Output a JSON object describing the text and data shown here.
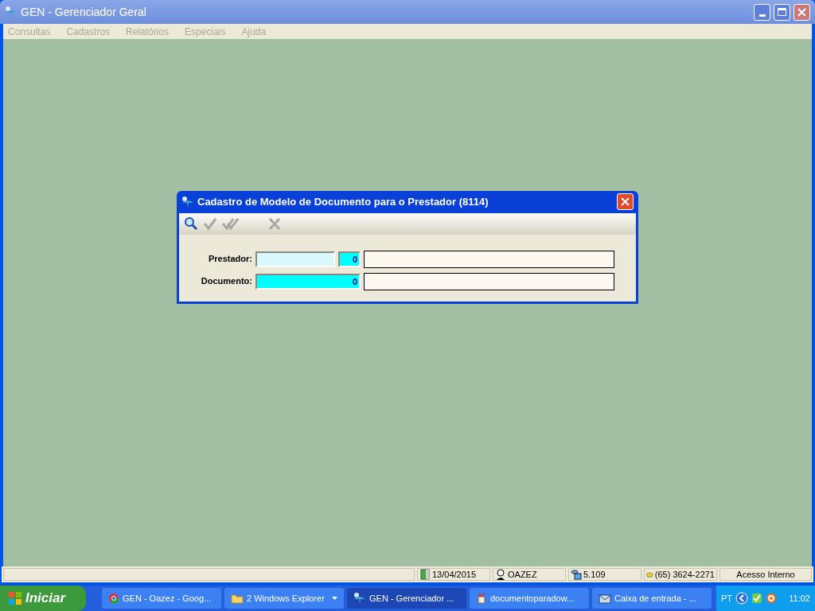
{
  "window": {
    "title": "GEN - Gerenciador Geral"
  },
  "menu": [
    {
      "label": "Consultas",
      "disabled": true
    },
    {
      "label": "Cadastros",
      "disabled": true
    },
    {
      "label": "Relatórios",
      "disabled": true
    },
    {
      "label": "Especiais",
      "disabled": true
    },
    {
      "label": "Ajuda",
      "disabled": true
    }
  ],
  "dialog": {
    "title": "Cadastro de Modelo de Documento para o Prestador (8114)",
    "toolbar": [
      {
        "kind": "search",
        "disabled": false
      },
      {
        "kind": "confirm",
        "disabled": true
      },
      {
        "kind": "confirm-all",
        "disabled": true
      },
      {
        "kind": "cancel",
        "disabled": true
      }
    ],
    "fields": [
      {
        "label": "Prestador:",
        "kind": "pair",
        "number": "0"
      },
      {
        "label": "Documento:",
        "kind": "single",
        "number": "0"
      }
    ]
  },
  "status_bar": [
    {
      "kind": "date",
      "text": "13/04/2015"
    },
    {
      "kind": "user",
      "text": "OAZEZ"
    },
    {
      "kind": "version",
      "text": "5.109"
    },
    {
      "kind": "phone",
      "text": "(65) 3624-2271"
    },
    {
      "kind": "plain",
      "text": "Acesso Interno"
    }
  ],
  "taskbar": {
    "start": "Iniciar",
    "items": [
      {
        "kind": "browser",
        "label": "GEN - Oazez - Goog...",
        "selected": false
      },
      {
        "kind": "folder",
        "label": "2 Windows Explorer",
        "selected": false,
        "group": true
      },
      {
        "kind": "app",
        "label": "GEN - Gerenciador ...",
        "selected": true
      },
      {
        "kind": "paint",
        "label": "documentoparadow...",
        "selected": false
      },
      {
        "kind": "mail",
        "label": "Caixa de entrada - ...",
        "selected": false
      }
    ],
    "tray": {
      "language": "PT",
      "clock": "11:02"
    }
  }
}
